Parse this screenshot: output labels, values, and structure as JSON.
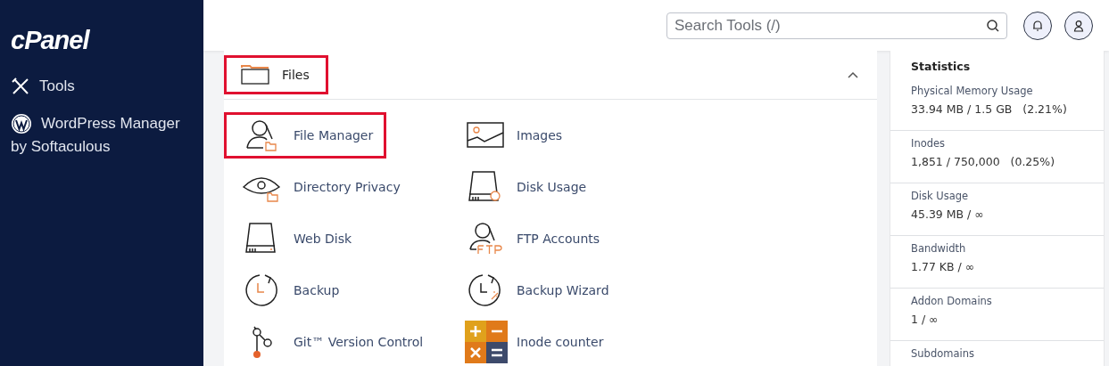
{
  "sidebar": {
    "logo": "cPanel",
    "items": [
      {
        "kind": "tools",
        "label": "Tools",
        "selected": false
      },
      {
        "kind": "wordpress",
        "label": "WordPress Manager",
        "sublabel": "by Softaculous",
        "selected": false
      }
    ]
  },
  "header": {
    "search": {
      "placeholder": "Search Tools (/)"
    }
  },
  "section": {
    "title": "Files",
    "expanded": true,
    "highlighted": true,
    "tools": [
      {
        "kind": "file-manager",
        "label": "File Manager",
        "highlighted": true
      },
      {
        "kind": "images",
        "label": "Images",
        "highlighted": false
      },
      {
        "kind": "directory-privacy",
        "label": "Directory Privacy",
        "highlighted": false
      },
      {
        "kind": "disk-usage",
        "label": "Disk Usage",
        "highlighted": false
      },
      {
        "kind": "web-disk",
        "label": "Web Disk",
        "highlighted": false
      },
      {
        "kind": "ftp-accounts",
        "label": "FTP Accounts",
        "highlighted": false
      },
      {
        "kind": "backup",
        "label": "Backup",
        "highlighted": false
      },
      {
        "kind": "backup-wizard",
        "label": "Backup Wizard",
        "highlighted": false
      },
      {
        "kind": "git",
        "label": "Git™ Version Control",
        "highlighted": false
      },
      {
        "kind": "inode-counter",
        "label": "Inode counter",
        "highlighted": false
      }
    ]
  },
  "statistics": {
    "title": "Statistics",
    "items": [
      {
        "label": "Physical Memory Usage",
        "value": "33.94 MB / 1.5 GB   (2.21%)"
      },
      {
        "label": "Inodes",
        "value": "1,851 / 750,000   (0.25%)"
      },
      {
        "label": "Disk Usage",
        "value": "45.39 MB / ∞"
      },
      {
        "label": "Bandwidth",
        "value": "1.77 KB / ∞"
      },
      {
        "label": "Addon Domains",
        "value": "1 / ∞"
      },
      {
        "label": "Subdomains"
      }
    ]
  }
}
